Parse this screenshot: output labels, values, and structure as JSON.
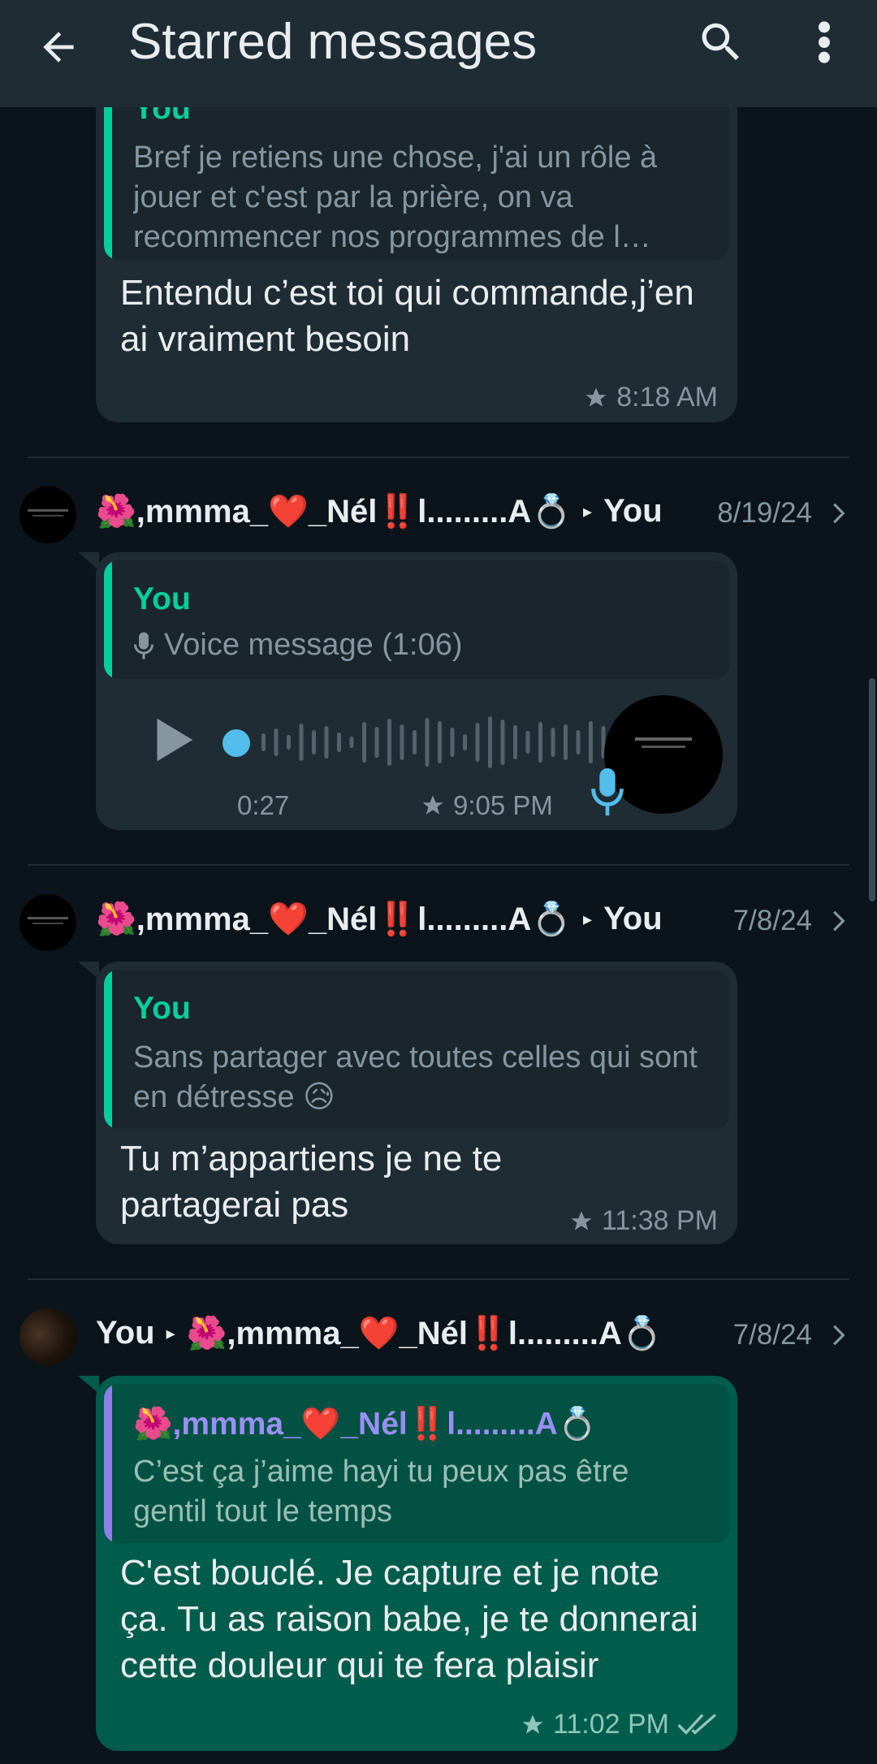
{
  "header": {
    "title": "Starred messages"
  },
  "messages": [
    {
      "quote_author": "You",
      "quote_text": "Bref je retiens une chose, j'ai un rôle à jouer et c'est par la prière, on va recommencer nos programmes de l…",
      "text": "Entendu c’est toi qui commande,j’en ai vraiment besoin",
      "time": "8:18 AM"
    },
    {
      "sender": "🌺,mmma_❤️_Nél‼️l.........A💍",
      "recipient": "You",
      "date": "8/19/24",
      "quote_author": "You",
      "quote_text": "Voice message (1:06)",
      "voice_position": "0:27",
      "voice_progress": 0.03,
      "time": "9:05 PM"
    },
    {
      "sender": "🌺,mmma_❤️_Nél‼️l.........A💍",
      "recipient": "You",
      "date": "7/8/24",
      "quote_author": "You",
      "quote_text": "Sans partager avec toutes celles qui sont en détresse 😥",
      "text": "Tu m’appartiens je ne te partagerai pas",
      "time": "11:38 PM"
    },
    {
      "sender": "You",
      "recipient": "🌺,mmma_❤️_Nél‼️l.........A💍",
      "date": "7/8/24",
      "quote_author": "🌺,mmma_❤️_Nél‼️l.........A💍",
      "quote_text": "C’est ça j’aime hayi tu peux pas être gentil tout le temps",
      "text": "C'est bouclé. Je capture et je note ça. Tu as raison babe, je te donnerai cette douleur qui te fera plaisir",
      "time": "11:02 PM"
    }
  ],
  "colors": {
    "background": "#0b141a",
    "appbar": "#1f2c34",
    "incoming_bubble": "#202c33",
    "outgoing_bubble": "#005c4b",
    "accent_green": "#06cf9c",
    "quote_purple": "#9a8ff5",
    "voice_dot": "#53bdeb"
  },
  "icons": {
    "back": "arrow-left-icon",
    "search": "search-icon",
    "menu": "more-vert-icon",
    "star": "star-icon",
    "play": "play-icon",
    "mic": "mic-icon",
    "double_check": "double-check-icon",
    "chevron": "chevron-right-icon"
  }
}
